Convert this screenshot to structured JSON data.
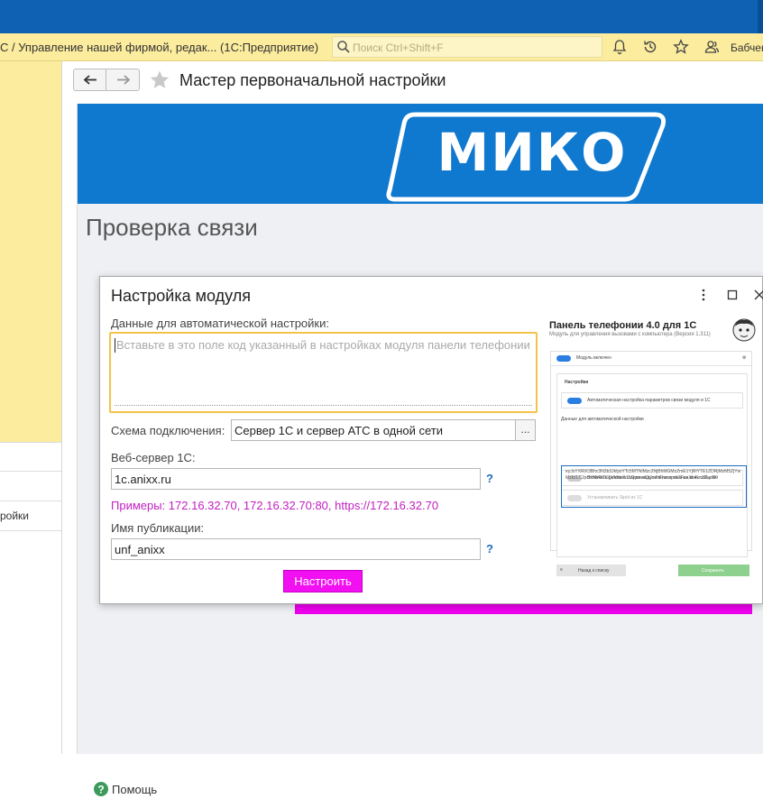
{
  "window": {
    "app_title": "С / Управление нашей фирмой, редак...  (1С:Предприятие)",
    "search_placeholder": "Поиск Ctrl+Shift+F",
    "user": "Бабчен"
  },
  "sidebar": {
    "items": [
      {
        "label": ""
      },
      {
        "label": ""
      },
      {
        "label": "ройки"
      }
    ]
  },
  "form": {
    "title": "Мастер первоначальной настройки",
    "banner_logo": "МИКО",
    "step_title": "Проверка связи",
    "help_label": "Помощь"
  },
  "modal": {
    "title": "Настройка модуля",
    "auto_data_label": "Данные для автоматической настройки:",
    "auto_data_placeholder": "Вставьте в это поле код указанный в настройках модуля панели телефонии",
    "scheme_label": "Схема подключения:",
    "scheme_value": "Сервер 1С и сервер АТС в одной сети",
    "scheme_button": "...",
    "webserver_label": "Веб-сервер 1С:",
    "webserver_value": "1c.anixx.ru",
    "help_mark": "?",
    "examples": "Примеры: 172.16.32.70, 172.16.32.70:80, https://172.16.32.70",
    "publication_label": "Имя публикации:",
    "publication_value": "unf_anixx",
    "setup_button": "Настроить"
  },
  "preview": {
    "title": "Панель телефонии 4.0 для 1С",
    "subtitle": "Модуль для управления вызовами с компьютера (Версия 1.311)",
    "module_enabled": "Модуль включен",
    "tab_settings": "Настройки",
    "auto_setup": "Автоматическая настройка параметров связи модуля и 1С",
    "data_label": "Данные для автоматической настройки",
    "code": "eyJsYXRlX3Bhc3N3b3JkIjoiYTc5MTNlMzc2NjBhMGMzZmE1YjRlYTE1ZDRjMzM5ZjYwMzkzLCJpcHNNRCI6IjVkNzIiLCJ1cmwiOiJodHRwczovL2FuaXh4LnJ1LyJ9",
    "debug_mode": "Включить режим отладки модуля и логирования всех событий",
    "set_sipid": "Устанавливать SipId из 1С",
    "back_button": "Назад к списку",
    "save_button": "Сохранить"
  },
  "colors": {
    "topbar": "#0f62b3",
    "titlebar": "#fbec9e",
    "banner": "#0f78cf",
    "accent_magenta": "#f20ff2",
    "focus_border": "#f2c34a"
  }
}
